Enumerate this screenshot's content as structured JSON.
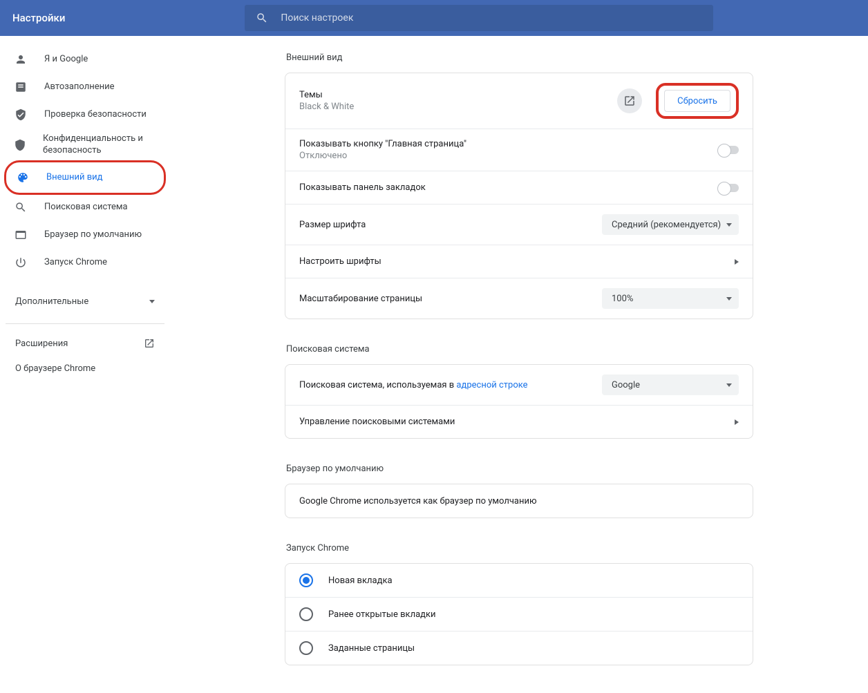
{
  "header": {
    "title": "Настройки",
    "search_placeholder": "Поиск настроек"
  },
  "sidebar": {
    "items": [
      {
        "label": "Я и Google"
      },
      {
        "label": "Автозаполнение"
      },
      {
        "label": "Проверка безопасности"
      },
      {
        "label": "Конфиденциальность и безопасность"
      },
      {
        "label": "Внешний вид"
      },
      {
        "label": "Поисковая система"
      },
      {
        "label": "Браузер по умолчанию"
      },
      {
        "label": "Запуск Chrome"
      }
    ],
    "advanced": "Дополнительные",
    "extensions": "Расширения",
    "about": "О браузере Chrome"
  },
  "appearance": {
    "heading": "Внешний вид",
    "themes_title": "Темы",
    "themes_sub": "Black & White",
    "reset_label": "Сбросить",
    "home_title": "Показывать кнопку \"Главная страница\"",
    "home_sub": "Отключено",
    "bookmarks_title": "Показывать панель закладок",
    "font_size_title": "Размер шрифта",
    "font_size_value": "Средний (рекомендуется)",
    "customize_fonts": "Настроить шрифты",
    "page_zoom_title": "Масштабирование страницы",
    "page_zoom_value": "100%"
  },
  "search": {
    "heading": "Поисковая система",
    "engine_prefix": "Поисковая система, используемая в ",
    "engine_link": "адресной строке",
    "engine_value": "Google",
    "manage": "Управление поисковыми системами"
  },
  "default_browser": {
    "heading": "Браузер по умолчанию",
    "text": "Google Chrome используется как браузер по умолчанию"
  },
  "startup": {
    "heading": "Запуск Chrome",
    "options": [
      {
        "label": "Новая вкладка"
      },
      {
        "label": "Ранее открытые вкладки"
      },
      {
        "label": "Заданные страницы"
      }
    ]
  }
}
